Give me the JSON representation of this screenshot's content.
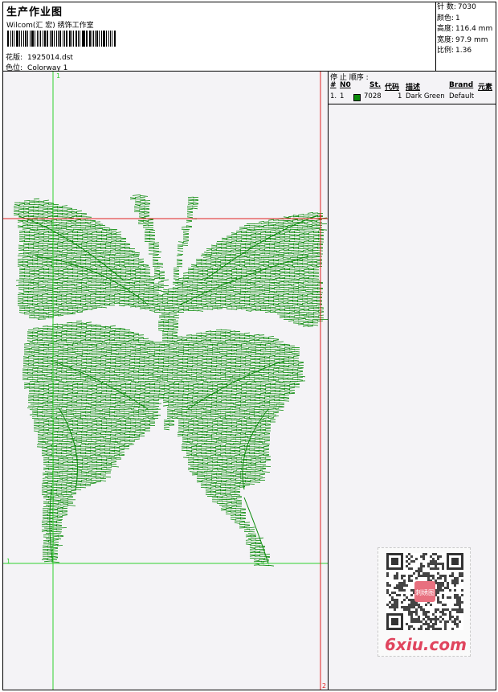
{
  "header": {
    "title": "生产作业图",
    "company": "Wilcom(汇 宏) 绣饰工作室",
    "design_label": "花版:",
    "design_value": "1925014.dst",
    "colorway_label": "色位:",
    "colorway_value": "Colorway 1"
  },
  "stats": {
    "stitches_label": "针 数:",
    "stitches": "7030",
    "colors_label": "颜色:",
    "colors": "1",
    "height_label": "高度:",
    "height": "116.4 mm",
    "width_label": "宽度:",
    "width": "97.9 mm",
    "ratio_label": "比例:",
    "ratio": "1.36"
  },
  "guides": {
    "label_top_left": "1",
    "label_right_top": "2",
    "label_left_bottom": "1",
    "label_right_bottom": "2",
    "guide_color": "#2fd02f",
    "red_color": "#e02020"
  },
  "sequence": {
    "title": "停 止 顺序 :",
    "headers": {
      "hash": "#",
      "no": "N0",
      "st": "St.",
      "code": "代码",
      "desc": "描述",
      "brand": "Brand",
      "elem": "元素"
    },
    "rows": [
      {
        "index": "1.",
        "no": "1",
        "st": "7028",
        "code": "1",
        "desc": "Dark Green",
        "brand": "Default",
        "color": "#0a8a0a"
      }
    ]
  },
  "design": {
    "thread_color": "#0a8a0a"
  },
  "watermark": {
    "text": "6xiu.com",
    "color": "#e0455e",
    "qr_center_text": "刺绣图"
  }
}
